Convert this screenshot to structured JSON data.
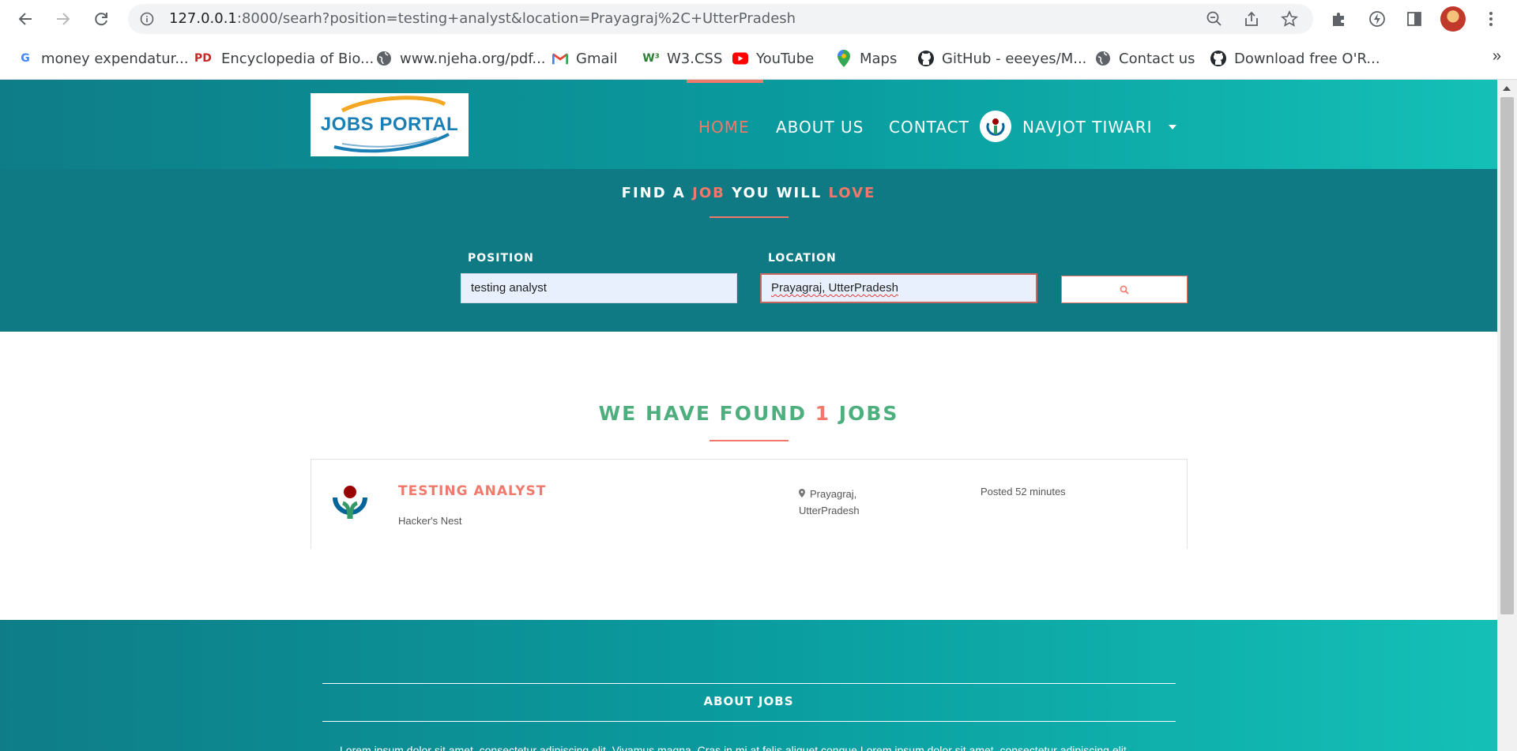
{
  "browser": {
    "url_host": "127.0.0.1",
    "url_path": ":8000/searh?position=testing+analyst&location=Prayagraj%2C+UtterPradesh",
    "bookmarks": [
      {
        "label": "money expendatur...",
        "icon": "google-icon"
      },
      {
        "label": "Encyclopedia of Bio...",
        "icon": "pd-icon"
      },
      {
        "label": "www.njeha.org/pdf...",
        "icon": "globe-icon"
      },
      {
        "label": "Gmail",
        "icon": "gmail-icon"
      },
      {
        "label": "W3.CSS",
        "icon": "w3-icon"
      },
      {
        "label": "YouTube",
        "icon": "youtube-icon"
      },
      {
        "label": "Maps",
        "icon": "maps-icon"
      },
      {
        "label": "GitHub - eeeyes/M...",
        "icon": "github-icon"
      },
      {
        "label": "Contact us",
        "icon": "globe-icon"
      },
      {
        "label": "Download free O'R...",
        "icon": "github-icon"
      }
    ],
    "bookmarks_more": "»"
  },
  "header": {
    "logo_text": "JOBS PORTAL",
    "menu": [
      {
        "label": "HOME",
        "active": true
      },
      {
        "label": "ABOUT US",
        "active": false
      },
      {
        "label": "CONTACT",
        "active": false
      }
    ],
    "user_name": "NAVJOT TIWARI"
  },
  "search": {
    "title_parts": [
      "FIND A ",
      "JOB",
      " YOU WILL ",
      "LOVE"
    ],
    "position_label": "POSITION",
    "position_value": "testing analyst",
    "location_label": "LOCATION",
    "location_value": "Prayagraj, UtterPradesh",
    "button_icon": "search-icon"
  },
  "results": {
    "title_before": "WE HAVE FOUND ",
    "count": "1",
    "title_after": " JOBS",
    "jobs": [
      {
        "title": "TESTING ANALYST",
        "company": "Hacker's Nest",
        "location_line1": "Prayagraj,",
        "location_line2": "UtterPradesh",
        "posted": "Posted 52 minutes"
      }
    ]
  },
  "footer": {
    "title": "ABOUT JOBS",
    "text": "Lorem ipsum dolor sit amet, consectetur adipiscing elit. Vivamus magna. Cras in mi at felis aliquet congue.Lorem ipsum dolor sit amet, consectetur adipiscing elit."
  },
  "colors": {
    "accent": "#f2786c",
    "teal_dark": "#0f7a83",
    "teal_light": "#14c0b6",
    "results_green": "#4caf7d"
  }
}
